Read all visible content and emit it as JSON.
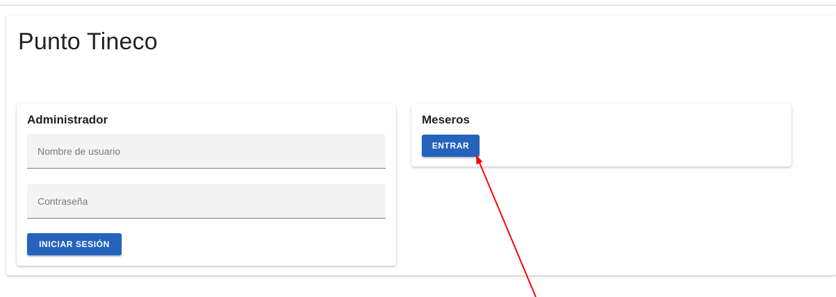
{
  "page": {
    "title": "Punto Tineco"
  },
  "admin_card": {
    "title": "Administrador",
    "username_placeholder": "Nombre de usuario",
    "username_value": "",
    "password_placeholder": "Contraseña",
    "password_value": "",
    "login_button": "INICIAR SESIÓN"
  },
  "waiters_card": {
    "title": "Meseros",
    "enter_button": "ENTRAR"
  },
  "colors": {
    "primary_button": "#2563bd",
    "annotation_arrow": "#ff0000"
  }
}
